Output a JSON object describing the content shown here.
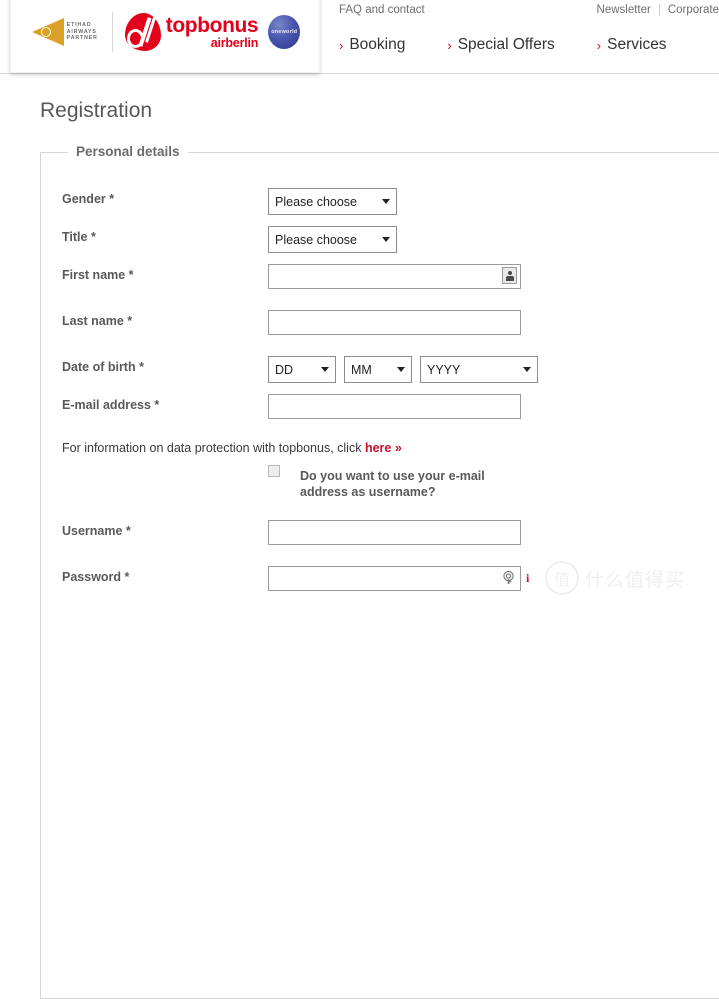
{
  "header": {
    "logo": {
      "etihad_line1": "ETIHAD",
      "etihad_line2": "AIRWAYS",
      "etihad_line3": "PARTNER",
      "topbonus_name": "topbonus",
      "topbonus_sub": "airberlin",
      "oneworld": "oneworld"
    },
    "faq_link": "FAQ and contact",
    "top_links": [
      {
        "label": "Newsletter"
      },
      {
        "label": "Corporate"
      }
    ],
    "nav": [
      {
        "label": "Booking",
        "chevron": "›"
      },
      {
        "label": "Special Offers",
        "chevron": "›"
      },
      {
        "label": "Services",
        "chevron": "›"
      }
    ]
  },
  "page": {
    "title": "Registration",
    "fieldset_legend": "Personal details"
  },
  "form": {
    "gender": {
      "label": "Gender *",
      "value": "Please choose"
    },
    "title": {
      "label": "Title *",
      "value": "Please choose"
    },
    "first_name": {
      "label": "First name *",
      "value": "",
      "placeholder": ""
    },
    "last_name": {
      "label": "Last name *",
      "value": "",
      "placeholder": ""
    },
    "date_of_birth": {
      "label": "Date of birth *",
      "day": "DD",
      "month": "MM",
      "year": "YYYY"
    },
    "email": {
      "label": "E-mail address *",
      "value": "",
      "placeholder": ""
    },
    "data_protection": {
      "text": "For information on data protection with topbonus, click ",
      "link": "here »"
    },
    "email_as_username": {
      "checked": false,
      "label": "Do you want to use your e-mail address as username?"
    },
    "username": {
      "label": "Username *",
      "value": "",
      "placeholder": ""
    },
    "password": {
      "label": "Password *",
      "value": "",
      "placeholder": "",
      "info": "i"
    }
  },
  "watermark": {
    "mark": "值",
    "text": "什么值得买"
  },
  "colors": {
    "brand_red": "#e2001a",
    "link_red": "#c8102e",
    "label_gray": "#58595b",
    "etihad_gold": "#d9a227",
    "oneworld_blue": "#4a56ae"
  }
}
